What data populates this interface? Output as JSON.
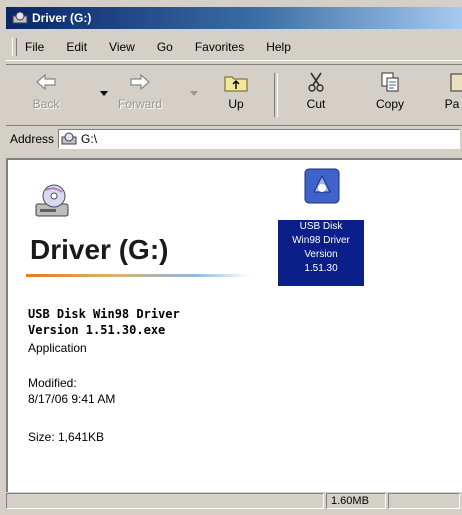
{
  "window": {
    "title": "Driver (G:)"
  },
  "menu": [
    "File",
    "Edit",
    "View",
    "Go",
    "Favorites",
    "Help"
  ],
  "toolbar": {
    "back": "Back",
    "forward": "Forward",
    "up": "Up",
    "cut": "Cut",
    "copy": "Copy",
    "paste": "Pa"
  },
  "address": {
    "label": "Address",
    "value": "G:\\"
  },
  "info_pane": {
    "drive_title": "Driver (G:)",
    "selected_name_line1": "USB Disk Win98 Driver",
    "selected_name_line2": "Version 1.51.30.exe",
    "selected_type": "Application",
    "modified_label": "Modified:",
    "modified_value": "8/17/06 9:41 AM",
    "size": "Size: 1,641KB"
  },
  "files": [
    {
      "label_lines": [
        "USB Disk",
        "Win98 Driver",
        "Version",
        "1.51.30"
      ],
      "icon": "installer-icon",
      "selected": true
    }
  ],
  "status": {
    "left": "",
    "right": "1.60MB"
  },
  "colors": {
    "title_start": "#0a246a",
    "title_end": "#a6caf0",
    "selection": "#0a1f8a",
    "chrome": "#d4d0c8"
  }
}
